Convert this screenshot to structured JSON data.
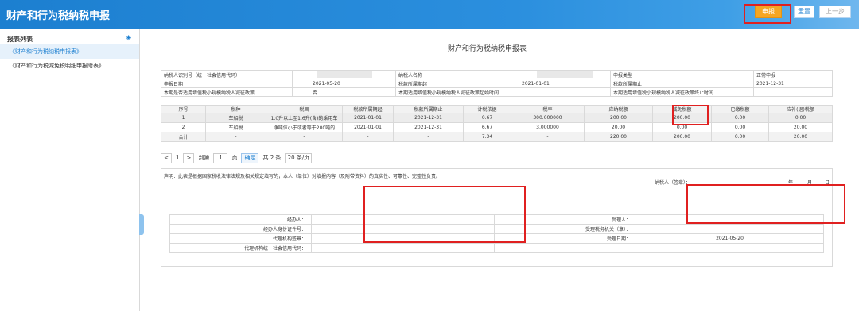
{
  "header": {
    "title": "财产和行为税纳税申报",
    "submit": "申报",
    "reset": "重置",
    "prev": "上一步"
  },
  "sidebar": {
    "title": "报表列表",
    "items": [
      "《财产和行为税纳税申报表》",
      "《财产和行为税减免税明细申报附表》"
    ]
  },
  "form": {
    "title": "财产和行为税纳税申报表",
    "info": {
      "taxpayer_id_label": "纳税人识别号（统一社会信用代码）",
      "taxpayer_name_label": "纳税人名称",
      "declare_type_label": "申报类型",
      "declare_type_value": "正常申报",
      "declare_date_label": "申报日期",
      "declare_date_value": "2021-05-20",
      "period_start_label": "税款所属期起",
      "period_start_value": "2021-01-01",
      "period_end_label": "税款所属期止",
      "period_end_value": "2021-12-31",
      "small_policy_label": "本期是否适用增值税小规模纳税人减征政策",
      "small_policy_value": "否",
      "policy_start_label": "本期适用增值税小规模纳税人减征政策起始时间",
      "policy_end_label": "本期适用增值税小规模纳税人减征政策终止时间"
    },
    "columns": [
      "序号",
      "税种",
      "税目",
      "税款所属期起",
      "税款所属期止",
      "计税依据",
      "税率",
      "应纳税额",
      "减免税额",
      "已缴税额",
      "应补(退)税额"
    ],
    "rows": [
      [
        "1",
        "车船税",
        "1.0升以上至1.6升(含)的乘用车",
        "2021-01-01",
        "2021-12-31",
        "0.67",
        "300.000000",
        "200.00",
        "200.00",
        "0.00",
        "0.00"
      ],
      [
        "2",
        "车船税",
        "净吨位小于或者等于200吨的",
        "2021-01-01",
        "2021-12-31",
        "6.67",
        "3.000000",
        "20.00",
        "0.00",
        "0.00",
        "20.00"
      ]
    ],
    "total": [
      "合计",
      "-",
      "-",
      "-",
      "-",
      "7.34",
      "-",
      "220.00",
      "200.00",
      "0.00",
      "20.00"
    ]
  },
  "pager": {
    "prev": "<",
    "page": "1",
    "next": ">",
    "goto": "到第",
    "page_input": "1",
    "page_unit": "页",
    "confirm": "确定",
    "total": "共 2 条",
    "size": "20 条/页"
  },
  "declaration": {
    "text": "声明：此表是根据国家税收法律法规及相关规定填写的，本人（单位）对填报内容（及附带资料）的真实性、可靠性、完整性负责。",
    "sign": "纳税人（签章）：",
    "year": "年",
    "month": "月",
    "day": "日",
    "handler": "经办人：",
    "handler_id": "经办人身份证件号：",
    "agency": "代理机构签章：",
    "agency_code": "代理机构统一社会信用代码：",
    "receiver": "受理人：",
    "receiver_org": "受理税务机关（章）：",
    "receive_date": "受理日期：",
    "receive_date_value": "2021-05-20"
  },
  "colors": {
    "header": "#1c7fd0",
    "submit": "#f5a623",
    "highlight": "#e02020"
  }
}
